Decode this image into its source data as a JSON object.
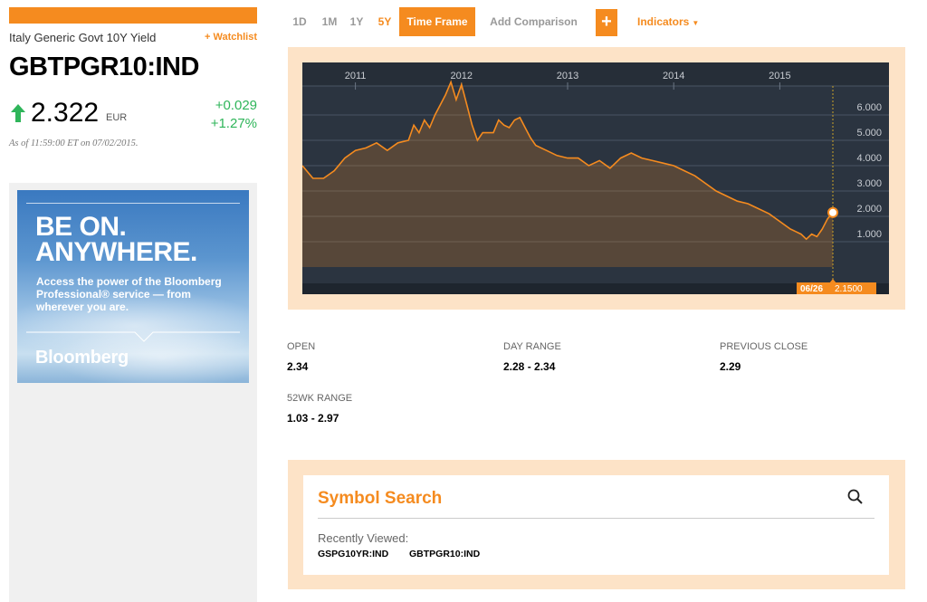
{
  "security": {
    "name": "Italy Generic Govt 10Y Yield",
    "watchlist_label": "+ Watchlist",
    "ticker": "GBTPGR10:IND",
    "price": "2.322",
    "currency": "EUR",
    "change_abs": "+0.029",
    "change_pct": "+1.27%",
    "as_of": "As of 11:59:00 ET on 07/02/2015."
  },
  "ad": {
    "headline_1": "BE ON.",
    "headline_2": "ANYWHERE.",
    "body": "Access the power of the Bloomberg Professional® service — from wherever you are.",
    "brand": "Bloomberg"
  },
  "toolbar": {
    "ranges": [
      "1D",
      "1M",
      "1Y",
      "5Y"
    ],
    "active_range": "5Y",
    "time_frame_label": "Time Frame",
    "add_comparison_label": "Add Comparison",
    "plus_label": "+",
    "indicators_label": "Indicators"
  },
  "colors": {
    "accent": "#f58b1f",
    "positive": "#2fb55a",
    "chart_bg": "#2b3440",
    "chart_frame": "#fde3c7"
  },
  "chart_data": {
    "type": "area",
    "x_tick_labels": [
      "2011",
      "2012",
      "2013",
      "2014",
      "2015"
    ],
    "y_tick_labels": [
      "1.000",
      "2.000",
      "3.000",
      "4.000",
      "5.000",
      "6.000"
    ],
    "ylim": [
      0,
      7
    ],
    "tooltip_date": "06/26",
    "tooltip_value": "2.1500",
    "x": [
      2010.5,
      2010.6,
      2010.7,
      2010.8,
      2010.9,
      2011.0,
      2011.1,
      2011.2,
      2011.3,
      2011.4,
      2011.5,
      2011.55,
      2011.6,
      2011.65,
      2011.7,
      2011.75,
      2011.8,
      2011.85,
      2011.9,
      2011.95,
      2012.0,
      2012.05,
      2012.1,
      2012.15,
      2012.2,
      2012.3,
      2012.35,
      2012.4,
      2012.45,
      2012.5,
      2012.55,
      2012.6,
      2012.65,
      2012.7,
      2012.8,
      2012.9,
      2013.0,
      2013.1,
      2013.2,
      2013.3,
      2013.4,
      2013.5,
      2013.6,
      2013.7,
      2013.8,
      2013.9,
      2014.0,
      2014.1,
      2014.2,
      2014.3,
      2014.4,
      2014.5,
      2014.6,
      2014.7,
      2014.8,
      2014.9,
      2015.0,
      2015.1,
      2015.15,
      2015.2,
      2015.25,
      2015.3,
      2015.35,
      2015.4,
      2015.45,
      2015.5
    ],
    "values": [
      4.0,
      3.5,
      3.5,
      3.8,
      4.3,
      4.6,
      4.7,
      4.9,
      4.6,
      4.9,
      5.0,
      5.6,
      5.3,
      5.8,
      5.5,
      6.0,
      6.4,
      6.8,
      7.3,
      6.6,
      7.2,
      6.4,
      5.6,
      5.0,
      5.3,
      5.3,
      5.8,
      5.6,
      5.5,
      5.8,
      5.9,
      5.5,
      5.1,
      4.8,
      4.6,
      4.4,
      4.3,
      4.3,
      4.0,
      4.2,
      3.9,
      4.3,
      4.5,
      4.3,
      4.2,
      4.1,
      4.0,
      3.8,
      3.6,
      3.3,
      3.0,
      2.8,
      2.6,
      2.5,
      2.3,
      2.1,
      1.8,
      1.5,
      1.4,
      1.3,
      1.1,
      1.3,
      1.2,
      1.5,
      1.9,
      2.15
    ]
  },
  "stats": [
    {
      "label": "OPEN",
      "value": "2.34"
    },
    {
      "label": "DAY RANGE",
      "value": "2.28 - 2.34"
    },
    {
      "label": "PREVIOUS CLOSE",
      "value": "2.29"
    },
    {
      "label": "52WK RANGE",
      "value": "1.03 - 2.97"
    }
  ],
  "symbol_search": {
    "title": "Symbol Search",
    "recent_label": "Recently Viewed:",
    "recent_items": [
      "GSPG10YR:IND",
      "GBTPGR10:IND"
    ]
  }
}
